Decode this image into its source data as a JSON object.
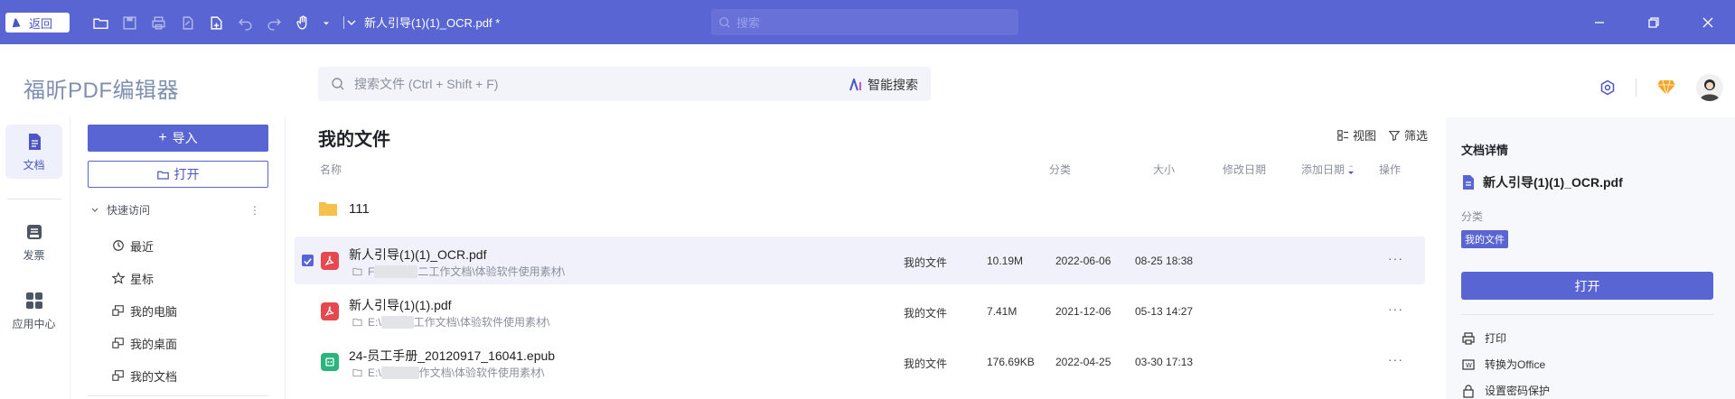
{
  "titlebar": {
    "back_label": "返回",
    "doc_title": "新人引导(1)(1)_OCR.pdf *",
    "search_placeholder": "搜索",
    "icons": [
      "open-folder-icon",
      "save-icon",
      "print-icon",
      "export-icon",
      "new-file-icon",
      "undo-icon",
      "redo-icon",
      "hand-tool-icon"
    ]
  },
  "brand": {
    "name": "福昕PDF编辑器"
  },
  "main_search": {
    "placeholder": "搜索文件 (Ctrl + Shift + F)",
    "ai_label": "智能搜索"
  },
  "leftnav": {
    "items": [
      {
        "label": "文档",
        "icon": "document-icon",
        "active": true
      },
      {
        "label": "发票",
        "icon": "invoice-icon",
        "active": false
      },
      {
        "label": "应用中心",
        "icon": "apps-icon",
        "active": false
      }
    ]
  },
  "sidepanel": {
    "import_label": "导入",
    "open_label": "打开",
    "quick_access_label": "快速访问",
    "items": [
      {
        "label": "最近",
        "icon": "clock-icon"
      },
      {
        "label": "星标",
        "icon": "star-icon"
      },
      {
        "label": "我的电脑",
        "icon": "computer-icon"
      },
      {
        "label": "我的桌面",
        "icon": "desktop-icon"
      },
      {
        "label": "我的文档",
        "icon": "documents-icon"
      }
    ]
  },
  "content": {
    "title": "我的文件",
    "view_label": "视图",
    "filter_label": "筛选",
    "columns": {
      "name": "名称",
      "category": "分类",
      "size": "大小",
      "modified": "修改日期",
      "added": "添加日期",
      "actions": "操作"
    },
    "folder": {
      "name": "111"
    },
    "files": [
      {
        "name": "新人引导(1)(1)_OCR.pdf",
        "path_prefix": "F",
        "path_suffix": "二工作文档\\体验软件使用素材\\",
        "category": "我的文件",
        "size": "10.19M",
        "modified": "2022-06-06",
        "added": "08-25 18:38",
        "type": "pdf",
        "selected": true
      },
      {
        "name": "新人引导(1)(1).pdf",
        "path_prefix": "E:\\",
        "path_suffix": "工作文档\\体验软件使用素材\\",
        "category": "我的文件",
        "size": "7.41M",
        "modified": "2021-12-06",
        "added": "05-13 14:27",
        "type": "pdf",
        "selected": false
      },
      {
        "name": "24-员工手册_20120917_16041.epub",
        "path_prefix": "E:\\",
        "path_suffix": "作文档\\体验软件使用素材\\",
        "category": "我的文件",
        "size": "176.69KB",
        "modified": "2022-04-25",
        "added": "03-30 17:13",
        "type": "epub",
        "selected": false
      }
    ],
    "more_label": "···"
  },
  "details": {
    "title": "文档详情",
    "file_name": "新人引导(1)(1)_OCR.pdf",
    "category_label": "分类",
    "category_value": "我的文件",
    "open_label": "打开",
    "actions": [
      {
        "label": "打印",
        "icon": "print-icon"
      },
      {
        "label": "转换为Office",
        "icon": "convert-icon"
      },
      {
        "label": "设置密码保护",
        "icon": "lock-icon"
      }
    ]
  },
  "colors": {
    "accent": "#5965d2",
    "titlebar": "#5965d2",
    "pdf_red": "#e5484d",
    "epub_green": "#2bb57d"
  }
}
